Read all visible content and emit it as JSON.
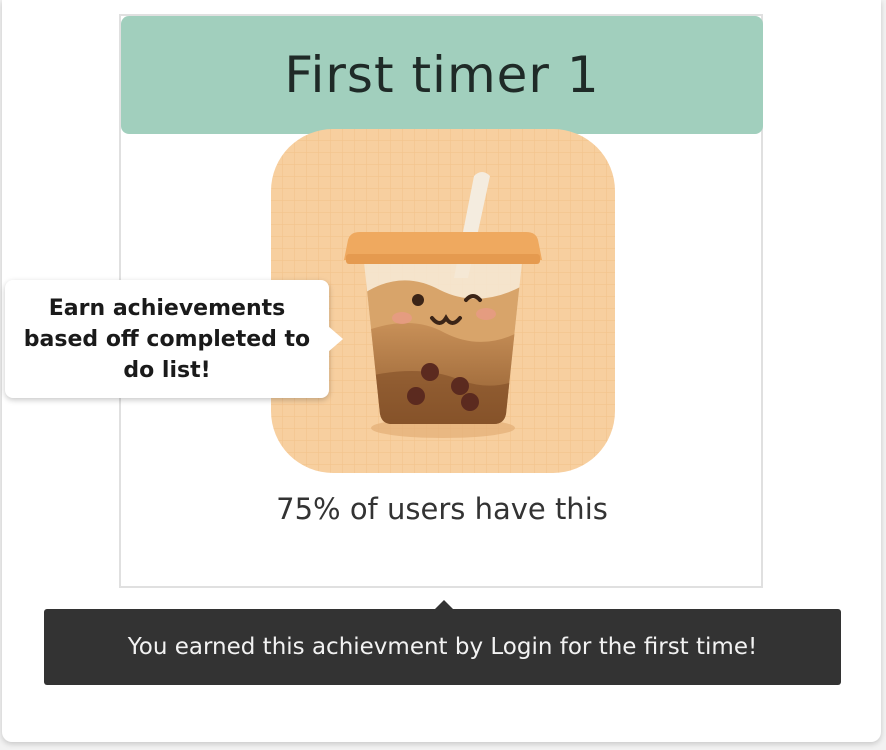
{
  "achievement": {
    "title": "First timer 1",
    "icon": "bubble-tea-cup-icon",
    "rarity_text": "75% of users have this"
  },
  "callout": {
    "text": "Earn achievements based off completed to do list!"
  },
  "tooltip": {
    "text": "You earned this achievment by Login for the first time!"
  },
  "colors": {
    "title_bar": "#a1cfbd",
    "icon_background": "#f7cfa0",
    "tooltip_background": "#333333"
  }
}
